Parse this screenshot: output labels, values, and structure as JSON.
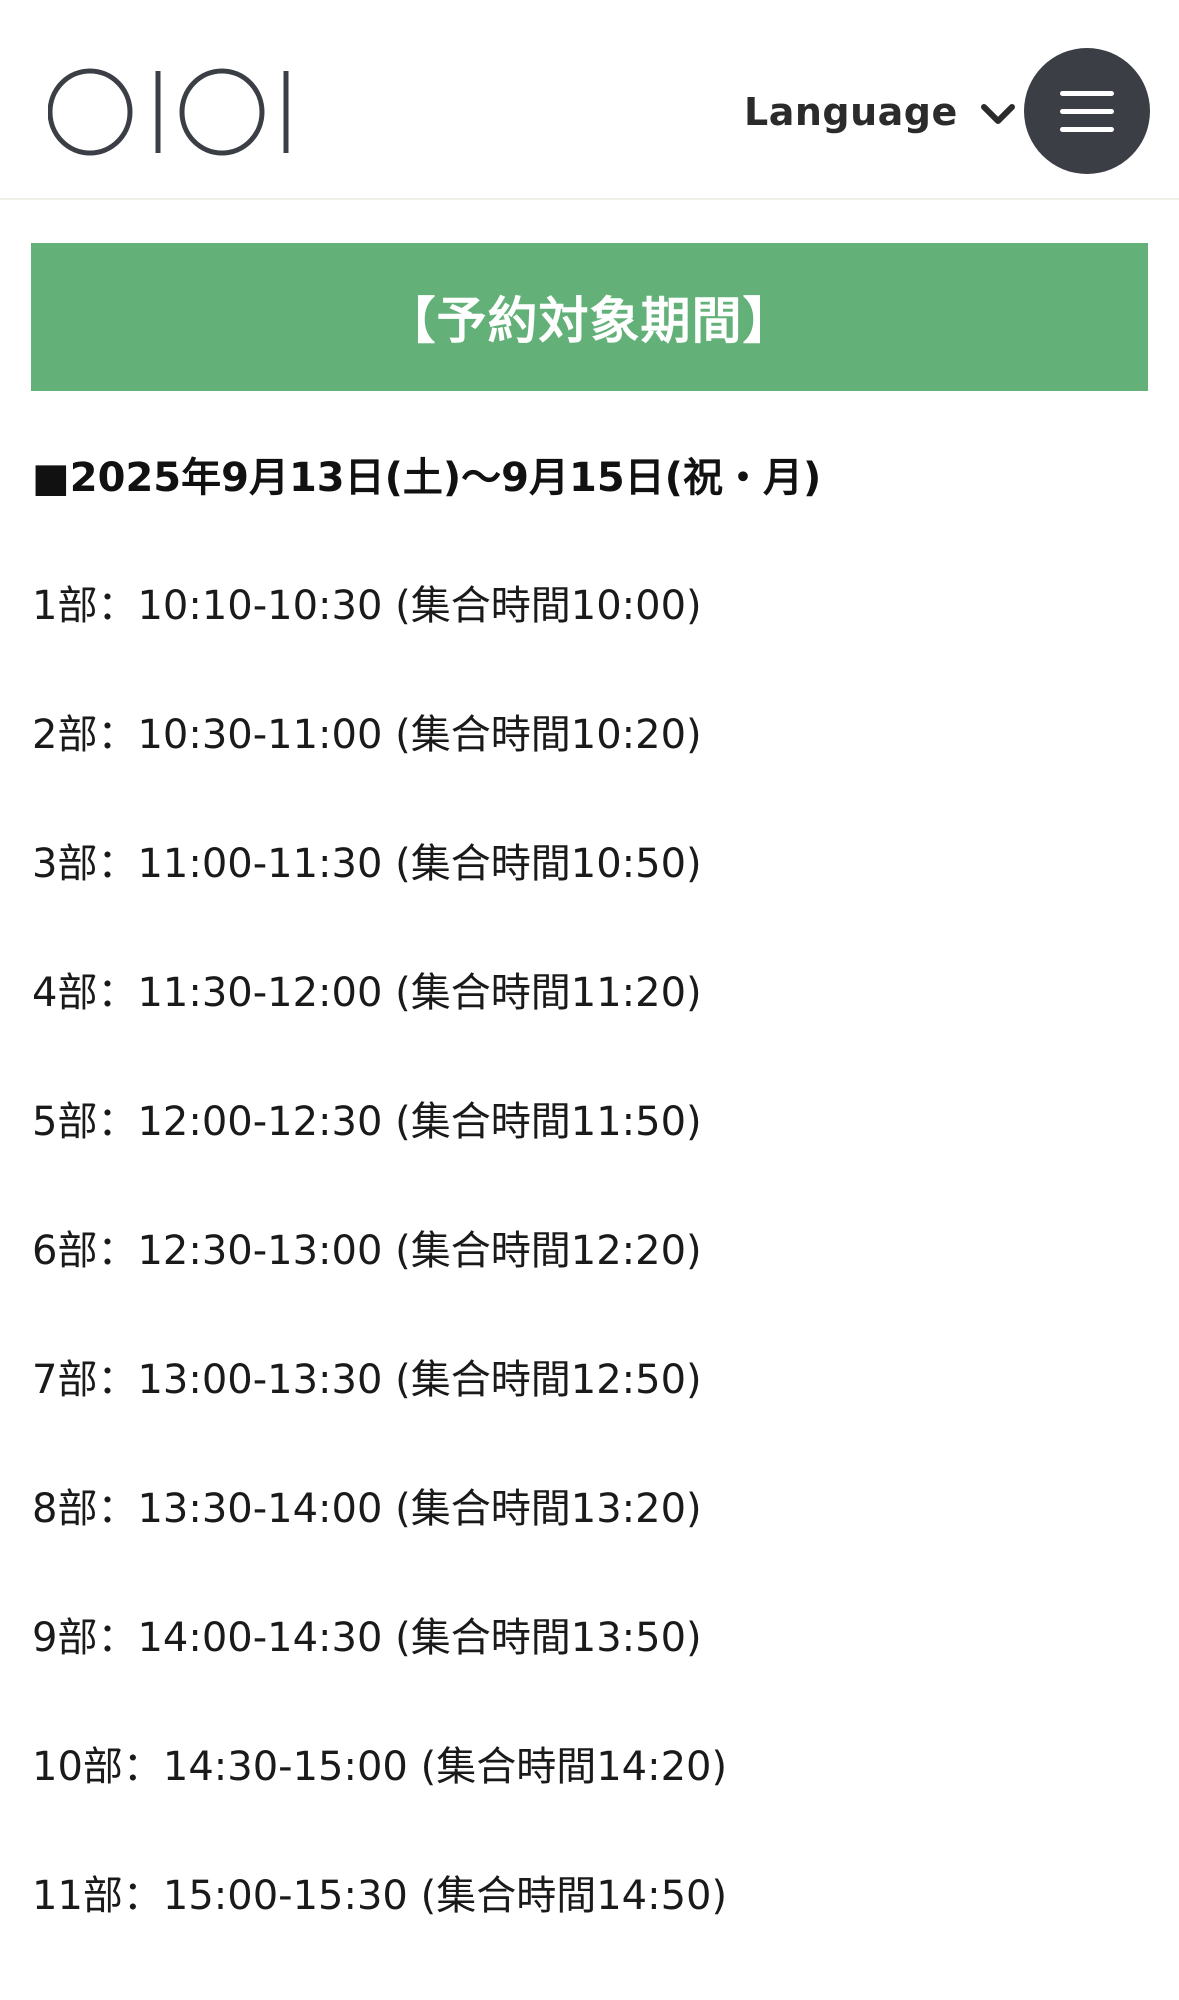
{
  "header": {
    "logo_alt": "OIOI",
    "language_label": "Language",
    "icons": {
      "language_toggle": "chevron-down-icon",
      "menu": "hamburger-menu-icon"
    }
  },
  "banner": {
    "title": "【予約対象期間】",
    "color": "#63b178"
  },
  "period": {
    "heading": "■2025年9月13日(土)〜9月15日(祝・月)"
  },
  "schedule": [
    "1部：10:10-10:30 (集合時間10:00)",
    "2部：10:30-11:00 (集合時間10:20)",
    "3部：11:00-11:30 (集合時間10:50)",
    "4部：11:30-12:00 (集合時間11:20)",
    "5部：12:00-12:30 (集合時間11:50)",
    "6部：12:30-13:00 (集合時間12:20)",
    "7部：13:00-13:30 (集合時間12:50)",
    "8部：13:30-14:00 (集合時間13:20)",
    "9部：14:00-14:30 (集合時間13:50)",
    "10部：14:30-15:00 (集合時間14:20)",
    "11部：15:00-15:30 (集合時間14:50)"
  ]
}
